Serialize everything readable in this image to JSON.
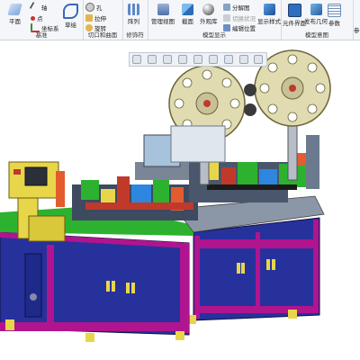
{
  "ribbon": {
    "groups": [
      {
        "title": "基准",
        "items": [
          "平面",
          "轴",
          "点",
          "坐标系",
          "草绘"
        ]
      },
      {
        "title": "切口和曲面",
        "items": [
          "孔",
          "拉伸",
          "旋转"
        ]
      },
      {
        "title": "修饰符",
        "items": [
          "阵列"
        ]
      },
      {
        "title": "模型显示",
        "items": [
          "管理视图",
          "截面",
          "外观库",
          "分解图",
          "切换状况",
          "编辑位置",
          "显示样式"
        ]
      },
      {
        "title": "模型意图",
        "items": [
          "元件界面",
          "发布几何",
          "参数"
        ]
      }
    ],
    "overflow_label": "参"
  },
  "view_toolbar": {
    "buttons": [
      "zoom-fit",
      "zoom-in",
      "zoom-out",
      "repaint",
      "display-style",
      "saved-views",
      "datum-display",
      "spin-center",
      "annotation-display"
    ]
  },
  "viewport": {
    "description_colors": {
      "frame": "#b0148e",
      "panel": "#26319c",
      "table": "#55606f",
      "reel": "#e0dbb0",
      "yellow": "#e8d64a",
      "green": "#2db22f"
    }
  }
}
